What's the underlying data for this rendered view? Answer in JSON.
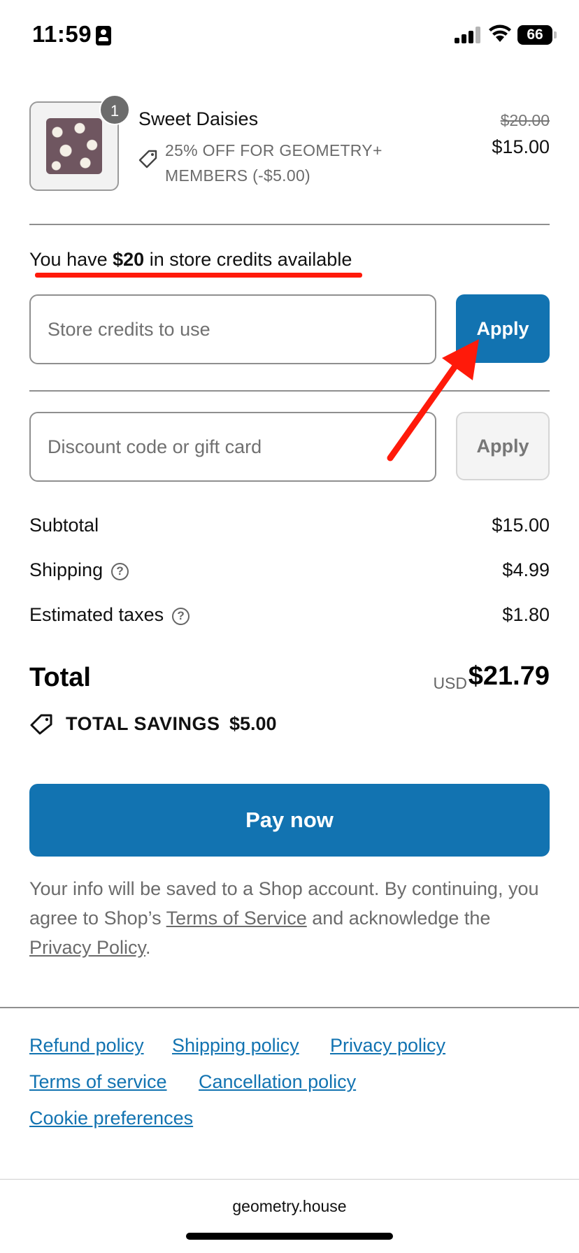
{
  "status_bar": {
    "time": "11:59",
    "battery": "66"
  },
  "product": {
    "quantity": "1",
    "name": "Sweet Daisies",
    "discount_label": "25% OFF FOR GEOMETRY+ MEMBERS (-$5.00)",
    "price_original": "$20.00",
    "price_final": "$15.00"
  },
  "store_credits": {
    "prefix": "You have ",
    "amount": "$20",
    "suffix": " in store credits available",
    "input_placeholder": "Store credits to use",
    "apply_label": "Apply"
  },
  "discount": {
    "input_placeholder": "Discount code or gift card",
    "apply_label": "Apply"
  },
  "summary": {
    "subtotal_label": "Subtotal",
    "subtotal_value": "$15.00",
    "shipping_label": "Shipping",
    "shipping_value": "$4.99",
    "taxes_label": "Estimated taxes",
    "taxes_value": "$1.80",
    "total_label": "Total",
    "total_currency": "USD",
    "total_value": "$21.79",
    "savings_label": "TOTAL SAVINGS",
    "savings_value": "$5.00"
  },
  "pay_button": "Pay now",
  "legal": {
    "part1": "Your info will be saved to a Shop account. By continuing, you agree to Shop’s ",
    "terms_link": "Terms of Service",
    "part2": " and acknowledge the ",
    "privacy_link": "Privacy Policy",
    "part3": "."
  },
  "footer_links": [
    "Refund policy",
    "Shipping policy",
    "Privacy policy",
    "Terms of service",
    "Cancellation policy",
    "Cookie preferences"
  ],
  "domain": "geometry.house",
  "colors": {
    "accent": "#1273b1",
    "annotation_red": "#ff1a0a"
  }
}
